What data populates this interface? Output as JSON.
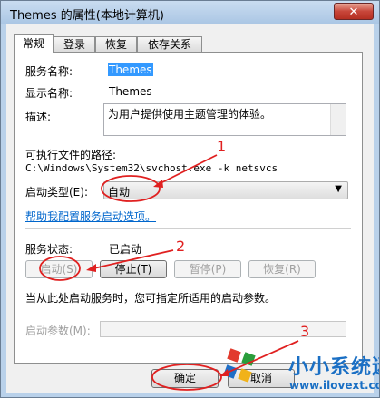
{
  "window": {
    "title": "Themes 的属性(本地计算机)",
    "close_glyph": "✕"
  },
  "tabs": [
    "常规",
    "登录",
    "恢复",
    "依存关系"
  ],
  "general": {
    "service_name_label": "服务名称:",
    "service_name_value": "Themes",
    "display_name_label": "显示名称:",
    "display_name_value": "Themes",
    "description_label": "描述:",
    "description_value": "为用户提供使用主题管理的体验。",
    "exe_path_label": "可执行文件的路径:",
    "exe_path_value": "C:\\Windows\\System32\\svchost.exe -k netsvcs",
    "startup_type_label": "启动类型(E):",
    "startup_type_value": "自动",
    "help_link": "帮助我配置服务启动选项。",
    "service_status_label": "服务状态:",
    "service_status_value": "已启动",
    "buttons": {
      "start": "启动(S)",
      "stop": "停止(T)",
      "pause": "暂停(P)",
      "resume": "恢复(R)"
    },
    "hint": "当从此处启动服务时，您可指定所适用的启动参数。",
    "start_params_label": "启动参数(M):",
    "start_params_value": ""
  },
  "footer": {
    "ok": "确定",
    "cancel": "取消"
  },
  "annotations": {
    "n1": "1",
    "n2": "2",
    "n3": "3",
    "color": "#e02020"
  },
  "watermark": {
    "text": "小小系统迷",
    "url": "www.ilovext.com"
  }
}
